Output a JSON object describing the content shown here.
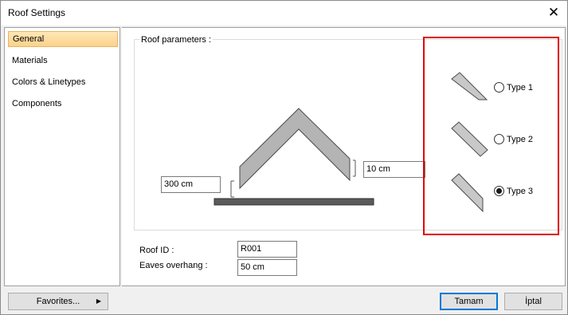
{
  "window": {
    "title": "Roof Settings",
    "close_glyph": "✕"
  },
  "sidebar": {
    "items": [
      {
        "label": "General",
        "active": true
      },
      {
        "label": "Materials",
        "active": false
      },
      {
        "label": "Colors & Linetypes",
        "active": false
      },
      {
        "label": "Components",
        "active": false
      }
    ]
  },
  "roof_parameters": {
    "legend": "Roof parameters :",
    "height_value": "300 cm",
    "thickness_value": "10 cm",
    "types": [
      {
        "label": "Type 1",
        "checked": false
      },
      {
        "label": "Type 2",
        "checked": false
      },
      {
        "label": "Type 3",
        "checked": true
      }
    ]
  },
  "form": {
    "roof_id_label": "Roof ID :",
    "roof_id_value": "R001",
    "eaves_label": "Eaves overhang :",
    "eaves_value": "50 cm"
  },
  "buttons": {
    "favorites": "Favorites...",
    "favorites_arrow": "▶",
    "ok": "Tamam",
    "cancel": "İptal"
  },
  "colors": {
    "highlight": "#e00000",
    "roof_fill": "#b4b4b4",
    "base_fill": "#5a5a5a",
    "active_item": "#fcd28a"
  }
}
